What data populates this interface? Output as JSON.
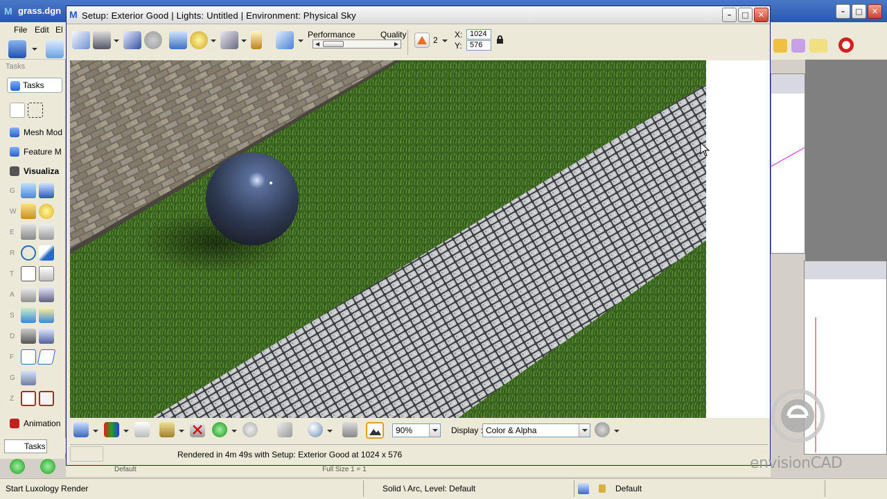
{
  "main_window": {
    "title": "grass.dgn",
    "menu": [
      "File",
      "Edit",
      "El"
    ]
  },
  "tasks_panel": {
    "label": "Tasks",
    "tab_label": "Tasks",
    "items": [
      "Mesh Mod",
      "Feature M",
      "Visualiza"
    ],
    "tool_letters": [
      "G",
      "W",
      "E",
      "R",
      "T",
      "A",
      "S",
      "D",
      "F",
      "G",
      "Z"
    ],
    "animation": "Animation",
    "bottom_tab": "Tasks"
  },
  "dialog": {
    "title": "Setup: Exterior Good | Lights: Untitled | Environment: Physical Sky",
    "performance_label": "Performance",
    "quality_label": "Quality",
    "antialias_value": "2",
    "x_label": "X:",
    "x_value": "1024",
    "y_label": "Y:",
    "y_value": "576",
    "zoom_value": "90%",
    "display_label": "Display :",
    "display_value": "Color & Alpha",
    "status_text": "Rendered in 4m 49s with Setup: Exterior Good at 1024 x 576"
  },
  "bg_fields": {
    "level": "Default",
    "scale": "Full Size 1 = 1"
  },
  "status_bar": {
    "prompt": "Start Luxology Render",
    "element_info": "Solid \\ Arc, Level: Default",
    "active_level": "Default"
  },
  "watermark": {
    "brand": "envisionCAD"
  },
  "colors": {
    "grass": "#3e6a22",
    "stone_path": "#b8bcc0",
    "brick": "#8a8478",
    "sphere": "#4a5a7a"
  }
}
